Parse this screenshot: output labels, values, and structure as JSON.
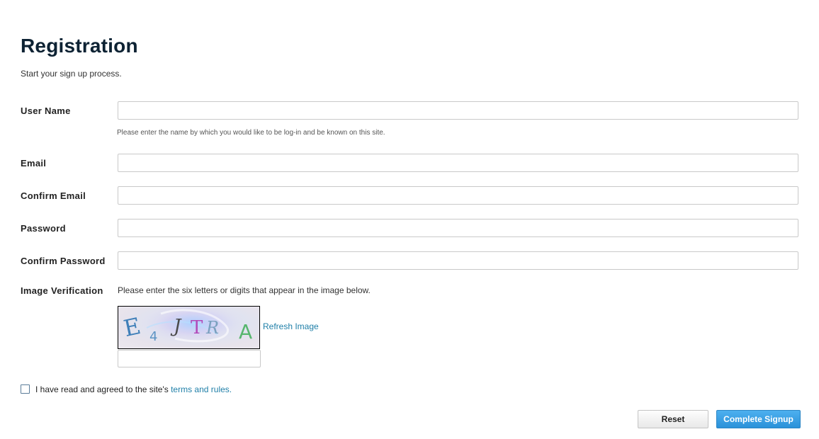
{
  "page": {
    "title": "Registration",
    "subtitle": "Start your sign up process."
  },
  "form": {
    "username": {
      "label": "User Name",
      "value": "",
      "hint": "Please enter the name by which you would like to be log-in and be known on this site."
    },
    "email": {
      "label": "Email",
      "value": ""
    },
    "confirm_email": {
      "label": "Confirm Email",
      "value": ""
    },
    "password": {
      "label": "Password",
      "value": ""
    },
    "confirm_password": {
      "label": "Confirm Password",
      "value": ""
    },
    "captcha": {
      "label": "Image Verification",
      "instructions": "Please enter the six letters or digits that appear in the image below.",
      "image_text": "E4JTRA",
      "refresh_label": "Refresh Image",
      "value": ""
    },
    "terms": {
      "checked": false,
      "prefix": "I have read and agreed to the site's ",
      "link_text": "terms and rules."
    }
  },
  "actions": {
    "reset_label": "Reset",
    "submit_label": "Complete Signup"
  },
  "colors": {
    "title": "#0d2233",
    "link": "#1f7fa8",
    "submit_bg": "#2a91d9"
  }
}
